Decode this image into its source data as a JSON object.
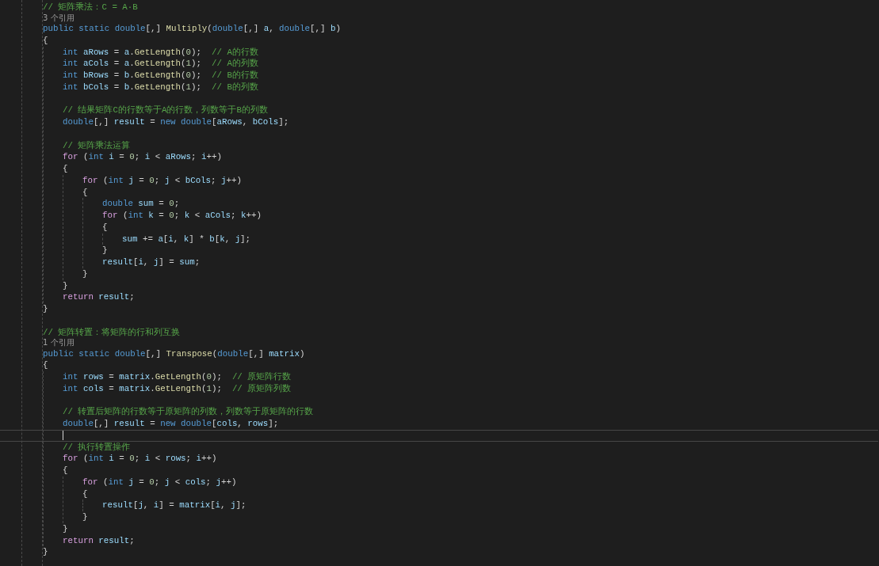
{
  "editor": {
    "lines": [
      {
        "kind": "code",
        "tokens": [
          {
            "kind": "comment",
            "text": "// 矩阵乘法：C = A·B"
          }
        ]
      },
      {
        "kind": "codelens",
        "text": "3 个引用"
      },
      {
        "kind": "code",
        "tokens": [
          {
            "kind": "keyword",
            "text": "public static double"
          },
          {
            "kind": "plain",
            "text": "[,] "
          },
          {
            "kind": "method",
            "text": "Multiply"
          },
          {
            "kind": "plain",
            "text": "("
          },
          {
            "kind": "keyword",
            "text": "double"
          },
          {
            "kind": "plain",
            "text": "[,] "
          },
          {
            "kind": "variable",
            "text": "a"
          },
          {
            "kind": "plain",
            "text": ", "
          },
          {
            "kind": "keyword",
            "text": "double"
          },
          {
            "kind": "plain",
            "text": "[,] "
          },
          {
            "kind": "variable",
            "text": "b"
          },
          {
            "kind": "plain",
            "text": ")"
          }
        ]
      },
      {
        "kind": "block",
        "open": "{",
        "close": "}",
        "children": [
          {
            "kind": "code",
            "tokens": [
              {
                "kind": "keyword",
                "text": "int "
              },
              {
                "kind": "variable",
                "text": "aRows"
              },
              {
                "kind": "plain",
                "text": " = "
              },
              {
                "kind": "variable",
                "text": "a"
              },
              {
                "kind": "plain",
                "text": "."
              },
              {
                "kind": "method",
                "text": "GetLength"
              },
              {
                "kind": "plain",
                "text": "("
              },
              {
                "kind": "number",
                "text": "0"
              },
              {
                "kind": "plain",
                "text": ");  "
              },
              {
                "kind": "comment",
                "text": "// A的行数"
              }
            ]
          },
          {
            "kind": "code",
            "tokens": [
              {
                "kind": "keyword",
                "text": "int "
              },
              {
                "kind": "variable",
                "text": "aCols"
              },
              {
                "kind": "plain",
                "text": " = "
              },
              {
                "kind": "variable",
                "text": "a"
              },
              {
                "kind": "plain",
                "text": "."
              },
              {
                "kind": "method",
                "text": "GetLength"
              },
              {
                "kind": "plain",
                "text": "("
              },
              {
                "kind": "number",
                "text": "1"
              },
              {
                "kind": "plain",
                "text": ");  "
              },
              {
                "kind": "comment",
                "text": "// A的列数"
              }
            ]
          },
          {
            "kind": "code",
            "tokens": [
              {
                "kind": "keyword",
                "text": "int "
              },
              {
                "kind": "variable",
                "text": "bRows"
              },
              {
                "kind": "plain",
                "text": " = "
              },
              {
                "kind": "variable",
                "text": "b"
              },
              {
                "kind": "plain",
                "text": "."
              },
              {
                "kind": "method",
                "text": "GetLength"
              },
              {
                "kind": "plain",
                "text": "("
              },
              {
                "kind": "number",
                "text": "0"
              },
              {
                "kind": "plain",
                "text": ");  "
              },
              {
                "kind": "comment",
                "text": "// B的行数"
              }
            ]
          },
          {
            "kind": "code",
            "tokens": [
              {
                "kind": "keyword",
                "text": "int "
              },
              {
                "kind": "variable",
                "text": "bCols"
              },
              {
                "kind": "plain",
                "text": " = "
              },
              {
                "kind": "variable",
                "text": "b"
              },
              {
                "kind": "plain",
                "text": "."
              },
              {
                "kind": "method",
                "text": "GetLength"
              },
              {
                "kind": "plain",
                "text": "("
              },
              {
                "kind": "number",
                "text": "1"
              },
              {
                "kind": "plain",
                "text": ");  "
              },
              {
                "kind": "comment",
                "text": "// B的列数"
              }
            ]
          },
          {
            "kind": "blank"
          },
          {
            "kind": "code",
            "tokens": [
              {
                "kind": "comment",
                "text": "// 结果矩阵C的行数等于A的行数，列数等于B的列数"
              }
            ]
          },
          {
            "kind": "code",
            "tokens": [
              {
                "kind": "keyword",
                "text": "double"
              },
              {
                "kind": "plain",
                "text": "[,] "
              },
              {
                "kind": "variable",
                "text": "result"
              },
              {
                "kind": "plain",
                "text": " = "
              },
              {
                "kind": "keyword",
                "text": "new double"
              },
              {
                "kind": "plain",
                "text": "["
              },
              {
                "kind": "variable",
                "text": "aRows"
              },
              {
                "kind": "plain",
                "text": ", "
              },
              {
                "kind": "variable",
                "text": "bCols"
              },
              {
                "kind": "plain",
                "text": "];"
              }
            ]
          },
          {
            "kind": "blank"
          },
          {
            "kind": "code",
            "tokens": [
              {
                "kind": "comment",
                "text": "// 矩阵乘法运算"
              }
            ]
          },
          {
            "kind": "code",
            "tokens": [
              {
                "kind": "control",
                "text": "for"
              },
              {
                "kind": "plain",
                "text": " ("
              },
              {
                "kind": "keyword",
                "text": "int "
              },
              {
                "kind": "variable",
                "text": "i"
              },
              {
                "kind": "plain",
                "text": " = "
              },
              {
                "kind": "number",
                "text": "0"
              },
              {
                "kind": "plain",
                "text": "; "
              },
              {
                "kind": "variable",
                "text": "i"
              },
              {
                "kind": "plain",
                "text": " < "
              },
              {
                "kind": "variable",
                "text": "aRows"
              },
              {
                "kind": "plain",
                "text": "; "
              },
              {
                "kind": "variable",
                "text": "i"
              },
              {
                "kind": "plain",
                "text": "++)"
              }
            ]
          },
          {
            "kind": "block",
            "open": "{",
            "close": "}",
            "children": [
              {
                "kind": "code",
                "tokens": [
                  {
                    "kind": "control",
                    "text": "for"
                  },
                  {
                    "kind": "plain",
                    "text": " ("
                  },
                  {
                    "kind": "keyword",
                    "text": "int "
                  },
                  {
                    "kind": "variable",
                    "text": "j"
                  },
                  {
                    "kind": "plain",
                    "text": " = "
                  },
                  {
                    "kind": "number",
                    "text": "0"
                  },
                  {
                    "kind": "plain",
                    "text": "; "
                  },
                  {
                    "kind": "variable",
                    "text": "j"
                  },
                  {
                    "kind": "plain",
                    "text": " < "
                  },
                  {
                    "kind": "variable",
                    "text": "bCols"
                  },
                  {
                    "kind": "plain",
                    "text": "; "
                  },
                  {
                    "kind": "variable",
                    "text": "j"
                  },
                  {
                    "kind": "plain",
                    "text": "++)"
                  }
                ]
              },
              {
                "kind": "block",
                "open": "{",
                "close": "}",
                "children": [
                  {
                    "kind": "code",
                    "tokens": [
                      {
                        "kind": "keyword",
                        "text": "double "
                      },
                      {
                        "kind": "variable",
                        "text": "sum"
                      },
                      {
                        "kind": "plain",
                        "text": " = "
                      },
                      {
                        "kind": "number",
                        "text": "0"
                      },
                      {
                        "kind": "plain",
                        "text": ";"
                      }
                    ]
                  },
                  {
                    "kind": "code",
                    "tokens": [
                      {
                        "kind": "control",
                        "text": "for"
                      },
                      {
                        "kind": "plain",
                        "text": " ("
                      },
                      {
                        "kind": "keyword",
                        "text": "int "
                      },
                      {
                        "kind": "variable",
                        "text": "k"
                      },
                      {
                        "kind": "plain",
                        "text": " = "
                      },
                      {
                        "kind": "number",
                        "text": "0"
                      },
                      {
                        "kind": "plain",
                        "text": "; "
                      },
                      {
                        "kind": "variable",
                        "text": "k"
                      },
                      {
                        "kind": "plain",
                        "text": " < "
                      },
                      {
                        "kind": "variable",
                        "text": "aCols"
                      },
                      {
                        "kind": "plain",
                        "text": "; "
                      },
                      {
                        "kind": "variable",
                        "text": "k"
                      },
                      {
                        "kind": "plain",
                        "text": "++)"
                      }
                    ]
                  },
                  {
                    "kind": "block",
                    "open": "{",
                    "close": "}",
                    "children": [
                      {
                        "kind": "code",
                        "tokens": [
                          {
                            "kind": "variable",
                            "text": "sum"
                          },
                          {
                            "kind": "plain",
                            "text": " += "
                          },
                          {
                            "kind": "variable",
                            "text": "a"
                          },
                          {
                            "kind": "plain",
                            "text": "["
                          },
                          {
                            "kind": "variable",
                            "text": "i"
                          },
                          {
                            "kind": "plain",
                            "text": ", "
                          },
                          {
                            "kind": "variable",
                            "text": "k"
                          },
                          {
                            "kind": "plain",
                            "text": "] * "
                          },
                          {
                            "kind": "variable",
                            "text": "b"
                          },
                          {
                            "kind": "plain",
                            "text": "["
                          },
                          {
                            "kind": "variable",
                            "text": "k"
                          },
                          {
                            "kind": "plain",
                            "text": ", "
                          },
                          {
                            "kind": "variable",
                            "text": "j"
                          },
                          {
                            "kind": "plain",
                            "text": "];"
                          }
                        ]
                      }
                    ]
                  },
                  {
                    "kind": "code",
                    "tokens": [
                      {
                        "kind": "variable",
                        "text": "result"
                      },
                      {
                        "kind": "plain",
                        "text": "["
                      },
                      {
                        "kind": "variable",
                        "text": "i"
                      },
                      {
                        "kind": "plain",
                        "text": ", "
                      },
                      {
                        "kind": "variable",
                        "text": "j"
                      },
                      {
                        "kind": "plain",
                        "text": "] = "
                      },
                      {
                        "kind": "variable",
                        "text": "sum"
                      },
                      {
                        "kind": "plain",
                        "text": ";"
                      }
                    ]
                  }
                ]
              }
            ]
          },
          {
            "kind": "code",
            "tokens": [
              {
                "kind": "control",
                "text": "return "
              },
              {
                "kind": "variable",
                "text": "result"
              },
              {
                "kind": "plain",
                "text": ";"
              }
            ]
          }
        ]
      },
      {
        "kind": "blank"
      },
      {
        "kind": "code",
        "tokens": [
          {
            "kind": "comment",
            "text": "// 矩阵转置：将矩阵的行和列互换"
          }
        ]
      },
      {
        "kind": "codelens",
        "text": "1 个引用"
      },
      {
        "kind": "code",
        "tokens": [
          {
            "kind": "keyword",
            "text": "public static double"
          },
          {
            "kind": "plain",
            "text": "[,] "
          },
          {
            "kind": "method",
            "text": "Transpose"
          },
          {
            "kind": "plain",
            "text": "("
          },
          {
            "kind": "keyword",
            "text": "double"
          },
          {
            "kind": "plain",
            "text": "[,] "
          },
          {
            "kind": "variable",
            "text": "matrix"
          },
          {
            "kind": "plain",
            "text": ")"
          }
        ]
      },
      {
        "kind": "block",
        "open": "{",
        "close": "}",
        "children": [
          {
            "kind": "code",
            "tokens": [
              {
                "kind": "keyword",
                "text": "int "
              },
              {
                "kind": "variable",
                "text": "rows"
              },
              {
                "kind": "plain",
                "text": " = "
              },
              {
                "kind": "variable",
                "text": "matrix"
              },
              {
                "kind": "plain",
                "text": "."
              },
              {
                "kind": "method",
                "text": "GetLength"
              },
              {
                "kind": "plain",
                "text": "("
              },
              {
                "kind": "number",
                "text": "0"
              },
              {
                "kind": "plain",
                "text": ");  "
              },
              {
                "kind": "comment",
                "text": "// 原矩阵行数"
              }
            ]
          },
          {
            "kind": "code",
            "tokens": [
              {
                "kind": "keyword",
                "text": "int "
              },
              {
                "kind": "variable",
                "text": "cols"
              },
              {
                "kind": "plain",
                "text": " = "
              },
              {
                "kind": "variable",
                "text": "matrix"
              },
              {
                "kind": "plain",
                "text": "."
              },
              {
                "kind": "method",
                "text": "GetLength"
              },
              {
                "kind": "plain",
                "text": "("
              },
              {
                "kind": "number",
                "text": "1"
              },
              {
                "kind": "plain",
                "text": ");  "
              },
              {
                "kind": "comment",
                "text": "// 原矩阵列数"
              }
            ]
          },
          {
            "kind": "blank"
          },
          {
            "kind": "code",
            "tokens": [
              {
                "kind": "comment",
                "text": "// 转置后矩阵的行数等于原矩阵的列数，列数等于原矩阵的行数"
              }
            ]
          },
          {
            "kind": "code",
            "tokens": [
              {
                "kind": "keyword",
                "text": "double"
              },
              {
                "kind": "plain",
                "text": "[,] "
              },
              {
                "kind": "variable",
                "text": "result"
              },
              {
                "kind": "plain",
                "text": " = "
              },
              {
                "kind": "keyword",
                "text": "new double"
              },
              {
                "kind": "plain",
                "text": "["
              },
              {
                "kind": "variable",
                "text": "cols"
              },
              {
                "kind": "plain",
                "text": ", "
              },
              {
                "kind": "variable",
                "text": "rows"
              },
              {
                "kind": "plain",
                "text": "];"
              }
            ]
          },
          {
            "kind": "cursor_line"
          },
          {
            "kind": "code",
            "tokens": [
              {
                "kind": "comment",
                "text": "// 执行转置操作"
              }
            ]
          },
          {
            "kind": "code",
            "tokens": [
              {
                "kind": "control",
                "text": "for"
              },
              {
                "kind": "plain",
                "text": " ("
              },
              {
                "kind": "keyword",
                "text": "int "
              },
              {
                "kind": "variable",
                "text": "i"
              },
              {
                "kind": "plain",
                "text": " = "
              },
              {
                "kind": "number",
                "text": "0"
              },
              {
                "kind": "plain",
                "text": "; "
              },
              {
                "kind": "variable",
                "text": "i"
              },
              {
                "kind": "plain",
                "text": " < "
              },
              {
                "kind": "variable",
                "text": "rows"
              },
              {
                "kind": "plain",
                "text": "; "
              },
              {
                "kind": "variable",
                "text": "i"
              },
              {
                "kind": "plain",
                "text": "++)"
              }
            ]
          },
          {
            "kind": "block",
            "open": "{",
            "close": "}",
            "children": [
              {
                "kind": "code",
                "tokens": [
                  {
                    "kind": "control",
                    "text": "for"
                  },
                  {
                    "kind": "plain",
                    "text": " ("
                  },
                  {
                    "kind": "keyword",
                    "text": "int "
                  },
                  {
                    "kind": "variable",
                    "text": "j"
                  },
                  {
                    "kind": "plain",
                    "text": " = "
                  },
                  {
                    "kind": "number",
                    "text": "0"
                  },
                  {
                    "kind": "plain",
                    "text": "; "
                  },
                  {
                    "kind": "variable",
                    "text": "j"
                  },
                  {
                    "kind": "plain",
                    "text": " < "
                  },
                  {
                    "kind": "variable",
                    "text": "cols"
                  },
                  {
                    "kind": "plain",
                    "text": "; "
                  },
                  {
                    "kind": "variable",
                    "text": "j"
                  },
                  {
                    "kind": "plain",
                    "text": "++)"
                  }
                ]
              },
              {
                "kind": "block",
                "open": "{",
                "close": "}",
                "children": [
                  {
                    "kind": "code",
                    "tokens": [
                      {
                        "kind": "variable",
                        "text": "result"
                      },
                      {
                        "kind": "plain",
                        "text": "["
                      },
                      {
                        "kind": "variable",
                        "text": "j"
                      },
                      {
                        "kind": "plain",
                        "text": ", "
                      },
                      {
                        "kind": "variable",
                        "text": "i"
                      },
                      {
                        "kind": "plain",
                        "text": "] = "
                      },
                      {
                        "kind": "variable",
                        "text": "matrix"
                      },
                      {
                        "kind": "plain",
                        "text": "["
                      },
                      {
                        "kind": "variable",
                        "text": "i"
                      },
                      {
                        "kind": "plain",
                        "text": ", "
                      },
                      {
                        "kind": "variable",
                        "text": "j"
                      },
                      {
                        "kind": "plain",
                        "text": "];"
                      }
                    ]
                  }
                ]
              }
            ]
          },
          {
            "kind": "code",
            "tokens": [
              {
                "kind": "control",
                "text": "return "
              },
              {
                "kind": "variable",
                "text": "result"
              },
              {
                "kind": "plain",
                "text": ";"
              }
            ]
          }
        ]
      }
    ]
  }
}
